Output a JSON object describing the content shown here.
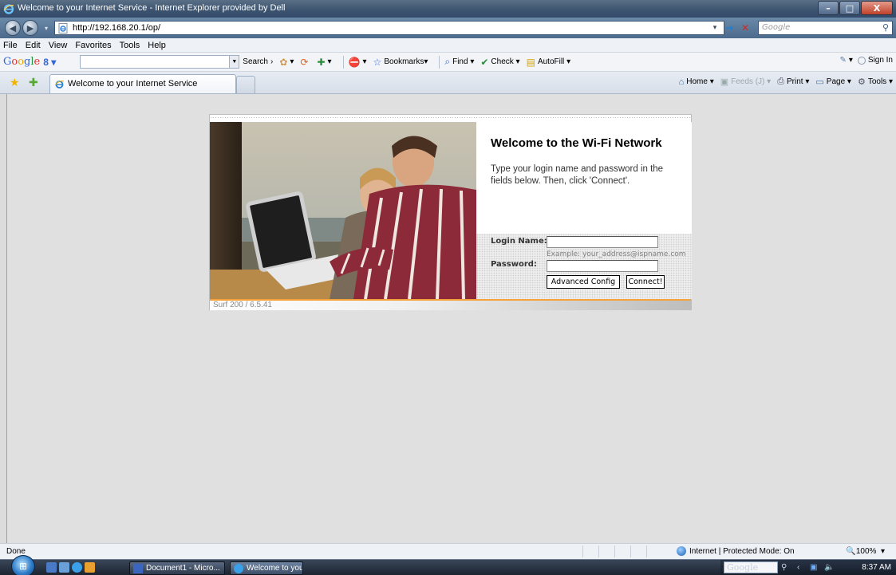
{
  "window": {
    "title": "Welcome to your Internet Service - Internet Explorer provided by Dell",
    "min_glyph": "–",
    "max_glyph": "□",
    "close_glyph": "X"
  },
  "address_bar": {
    "url": "http://192.168.20.1/op/",
    "search_placeholder": "Google",
    "go_glyph": "→",
    "stop_glyph": "✕",
    "dropdown_glyph": "▾"
  },
  "menu": {
    "items": [
      "File",
      "Edit",
      "View",
      "Favorites",
      "Tools",
      "Help"
    ]
  },
  "google_toolbar": {
    "logo": [
      "G",
      "o",
      "o",
      "g",
      "l",
      "e"
    ],
    "plus_label": "8 ▾",
    "search_label": "Search",
    "bookmarks_label": "Bookmarks",
    "find_label": "Find",
    "check_label": "Check",
    "autofill_label": "AutoFill",
    "sign_in_label": "Sign In"
  },
  "tabs": {
    "active_tab_label": "Welcome to your Internet Service"
  },
  "command_bar": {
    "home_label": "Home",
    "feeds_label": "Feeds (J)",
    "print_label": "Print",
    "page_label": "Page",
    "tools_label": "Tools"
  },
  "portal": {
    "welcome_title": "Welcome to the Wi-Fi Network",
    "welcome_text": "Type your login name and password in the fields below. Then, click 'Connect'.",
    "login_name_label": "Login Name:",
    "login_name_value": "",
    "login_hint": "Example: your_address@ispname.com",
    "password_label": "Password:",
    "password_value": "",
    "advanced_button": "Advanced Config",
    "connect_button": "Connect!",
    "version": "Surf 200 / 6.5.41"
  },
  "status_bar": {
    "status_text": "Done",
    "zone_text": "Internet | Protected Mode: On",
    "zoom_text": "100%",
    "zoom_icon": "🔍",
    "zoom_dropdown": "▾"
  },
  "taskbar": {
    "start_glyph": "⊞",
    "task1_label": "Document1 - Micro...",
    "task2_label": "Welcome to your In...",
    "tray_search_placeholder": "Google",
    "clock": "8:37 AM"
  },
  "colors": {
    "accent_orange": "#f6a23a",
    "titlebar": "#3e5570",
    "content_bg": "#e0e0e0"
  }
}
